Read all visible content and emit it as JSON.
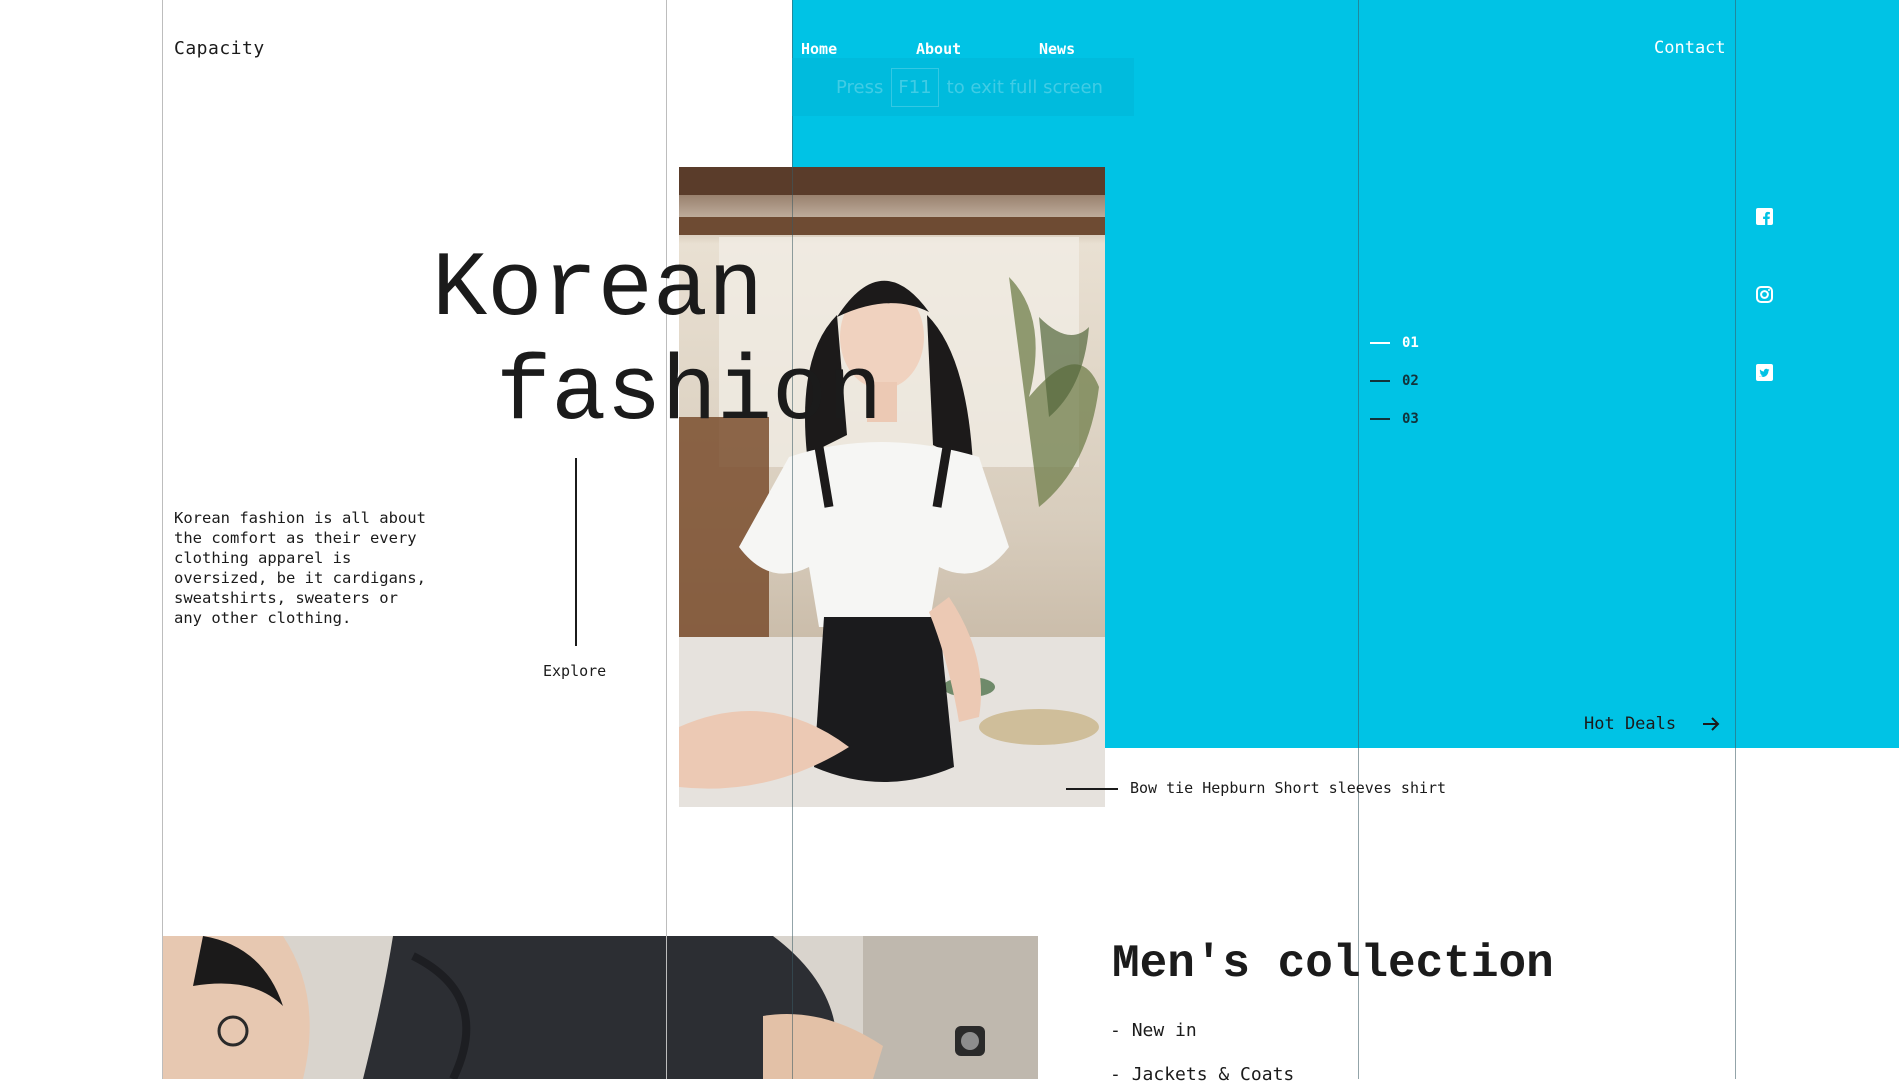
{
  "brand": {
    "logo": "Capacity"
  },
  "nav": {
    "home": "Home",
    "about": "About",
    "news": "News",
    "contact": "Contact"
  },
  "fullscreen_hint": {
    "pre": "Press",
    "key": "F11",
    "post": "to exit full screen"
  },
  "hero": {
    "title_line1": "Korean",
    "title_line2": "fashion",
    "description": "Korean fashion is all about the comfort as their every clothing apparel is oversized, be it cardigans, sweatshirts, sweaters or any other clothing.",
    "explore": "Explore"
  },
  "slider": {
    "items": [
      "01",
      "02",
      "03"
    ],
    "active_index": 1
  },
  "social": [
    "facebook-icon",
    "instagram-icon",
    "twitter-icon"
  ],
  "hot_deals": "Hot Deals",
  "product_caption": "Bow tie Hepburn Short sleeves shirt",
  "mens": {
    "title": "Men's collection",
    "items": [
      "New in",
      "Jackets & Coats"
    ]
  },
  "colors": {
    "accent": "#00c3e5",
    "text": "#1b1b1b",
    "background": "#ffffff"
  }
}
